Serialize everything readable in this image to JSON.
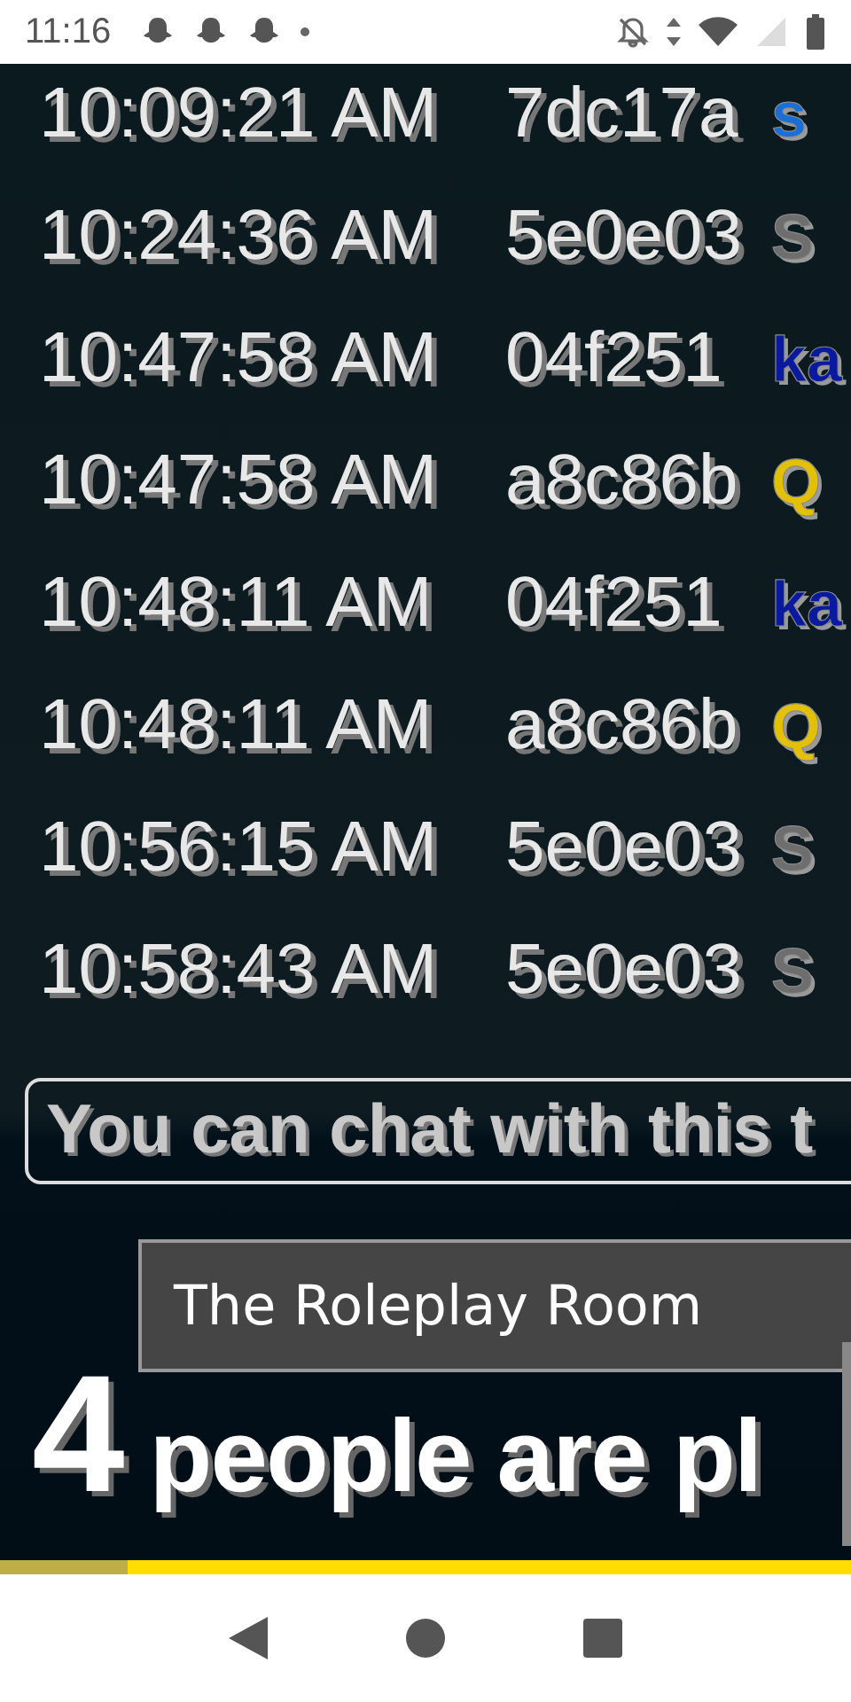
{
  "status_bar": {
    "time": "11:16"
  },
  "log": [
    {
      "time": "10:09:21 AM",
      "id": "7dc17a",
      "name": "s",
      "color": "#1a6fd6"
    },
    {
      "time": "10:24:36 AM",
      "id": "5e0e03",
      "name": "S",
      "color": "#6e6e6e"
    },
    {
      "time": "10:47:58 AM",
      "id": "04f251",
      "name": "ka",
      "color": "#0a1a9e"
    },
    {
      "time": "10:47:58 AM",
      "id": "a8c86b",
      "name": "Q",
      "color": "#e3c100"
    },
    {
      "time": "10:48:11 AM",
      "id": "04f251",
      "name": "ka",
      "color": "#0a1a9e"
    },
    {
      "time": "10:48:11 AM",
      "id": "a8c86b",
      "name": "Q",
      "color": "#e3c100"
    },
    {
      "time": "10:56:15 AM",
      "id": "5e0e03",
      "name": "S",
      "color": "#6e6e6e"
    },
    {
      "time": "10:58:43 AM",
      "id": "5e0e03",
      "name": "S",
      "color": "#6e6e6e"
    }
  ],
  "chat_notice": "You can chat with this t",
  "room": {
    "title": "The Roleplay Room",
    "count": "4",
    "caption": "people are pl"
  },
  "progress": {
    "level": 0.15
  }
}
